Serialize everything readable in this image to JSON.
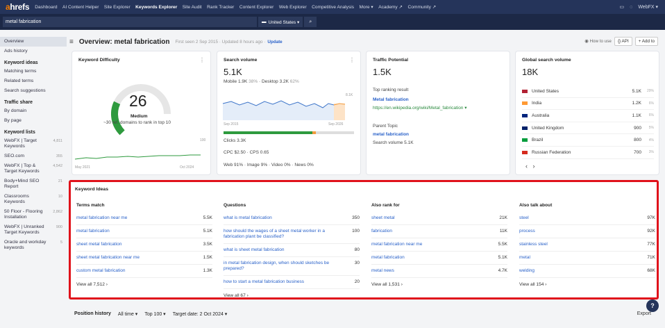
{
  "nav": {
    "logo_a": "a",
    "logo_rest": "hrefs",
    "items": [
      "Dashboard",
      "AI Content Helper",
      "Site Explorer",
      "Keywords Explorer",
      "Site Audit",
      "Rank Tracker",
      "Content Explorer",
      "Web Explorer",
      "Competitive Analysis",
      "More ▾",
      "Academy ↗",
      "Community ↗"
    ],
    "account": "WebFX ▾"
  },
  "search": {
    "value": "metal fabrication",
    "country": "United States ▾"
  },
  "sidebar": {
    "overview": "Overview",
    "ads": "Ads history",
    "ki_head": "Keyword ideas",
    "ki": [
      "Matching terms",
      "Related terms",
      "Search suggestions"
    ],
    "ts_head": "Traffic share",
    "ts": [
      "By domain",
      "By page"
    ],
    "kl_head": "Keyword lists",
    "lists": [
      {
        "name": "WebFX | Target Keywords",
        "count": "4,811"
      },
      {
        "name": "SEO.com",
        "count": "355"
      },
      {
        "name": "WebFX | Top & Target Keywords",
        "count": "4,542"
      },
      {
        "name": "Body+Mind SEO Report",
        "count": "21"
      },
      {
        "name": "Classrooms Keywords",
        "count": "10"
      },
      {
        "name": "50 Floor - Flooring Installation",
        "count": "2,862"
      },
      {
        "name": "WebFX | Unranked Target Keywords",
        "count": "900"
      },
      {
        "name": "Oracle and workday keywords",
        "count": "5"
      }
    ]
  },
  "header": {
    "title": "Overview: metal fabrication",
    "meta": "First seen 2 Sep 2015 · Updated 8 hours ago ·",
    "update": "Update",
    "how": "How to use",
    "api": "{} API",
    "add": "+ Add to"
  },
  "kd": {
    "title": "Keyword Difficulty",
    "value": "26",
    "level": "Medium",
    "desc": "~30 ref. domains to rank in top 10",
    "x0": "May 2021",
    "x1": "Oct 2024",
    "ymax": "100",
    "score": 26
  },
  "sv": {
    "title": "Search volume",
    "value": "5.1K",
    "mobile": "Mobile 1.9K",
    "mobile_pct": "38%",
    "desktop": "Desktop 3.2K",
    "desktop_pct": "62%",
    "ymax": "8.1K",
    "x0": "Sep 2015",
    "x1": "Sep 2026",
    "clicks": "Clicks 3.3K",
    "cpc": "CPC $2.50 · CPS 0.65",
    "types": "Web 91% · Image 9% · Video 0% · News 0%",
    "green": 0.68,
    "orange": 0.03
  },
  "tp": {
    "title": "Traffic Potential",
    "value": "1.5K",
    "trr": "Top ranking result",
    "res_title": "Metal fabrication",
    "res_url": "https://en.wikipedia.org/wiki/Metal_fabrication ▾",
    "pt": "Parent Topic",
    "pt_kw": "metal fabrication",
    "pt_sv": "Search volume 5.1K"
  },
  "gs": {
    "title": "Global search volume",
    "value": "18K",
    "rows": [
      {
        "c": "United States",
        "v": "5.1K",
        "p": "29%"
      },
      {
        "c": "India",
        "v": "1.2K",
        "p": "6%"
      },
      {
        "c": "Australia",
        "v": "1.1K",
        "p": "6%"
      },
      {
        "c": "United Kingdom",
        "v": "900",
        "p": "5%"
      },
      {
        "c": "Brazil",
        "v": "800",
        "p": "4%"
      },
      {
        "c": "Russian Federation",
        "v": "700",
        "p": "3%"
      }
    ],
    "flags": [
      "#b22234",
      "#ff9933",
      "#00247d",
      "#012169",
      "#009c3b",
      "#d52b1e"
    ]
  },
  "ki": {
    "title": "Keyword Ideas",
    "cols": [
      {
        "head": "Terms match",
        "rows": [
          {
            "k": "metal fabrication near me",
            "v": "5.5K"
          },
          {
            "k": "metal fabrication",
            "v": "5.1K"
          },
          {
            "k": "sheet metal fabrication",
            "v": "3.5K"
          },
          {
            "k": "sheet metal fabrication near me",
            "v": "1.5K"
          },
          {
            "k": "custom metal fabrication",
            "v": "1.3K"
          }
        ],
        "all": "View all 7,512  ›"
      },
      {
        "head": "Questions",
        "rows": [
          {
            "k": "what is metal fabrication",
            "v": "350"
          },
          {
            "k": "how should the wages of a sheet metal worker in a fabrication plant be classified?",
            "v": "100"
          },
          {
            "k": "what is sheet metal fabrication",
            "v": "80"
          },
          {
            "k": "in metal fabrication design, when should sketches be prepared?",
            "v": "30"
          },
          {
            "k": "how to start a metal fabrication business",
            "v": "20"
          }
        ],
        "all": "View all 67  ›"
      },
      {
        "head": "Also rank for",
        "rows": [
          {
            "k": "sheet metal",
            "v": "21K"
          },
          {
            "k": "fabrication",
            "v": "11K"
          },
          {
            "k": "metal fabrication near me",
            "v": "5.5K"
          },
          {
            "k": "metal fabrication",
            "v": "5.1K"
          },
          {
            "k": "metal news",
            "v": "4.7K"
          }
        ],
        "all": "View all 1,531  ›"
      },
      {
        "head": "Also talk about",
        "rows": [
          {
            "k": "steel",
            "v": "97K"
          },
          {
            "k": "process",
            "v": "92K"
          },
          {
            "k": "stainless steel",
            "v": "77K"
          },
          {
            "k": "metal",
            "v": "71K"
          },
          {
            "k": "welding",
            "v": "68K"
          }
        ],
        "all": "View all 154  ›"
      }
    ]
  },
  "ph": {
    "title": "Position history",
    "all": "All time ▾",
    "top": "Top 100 ▾",
    "date": "Target date: 2 Oct 2024 ▾",
    "export": "Export"
  },
  "help": "?"
}
